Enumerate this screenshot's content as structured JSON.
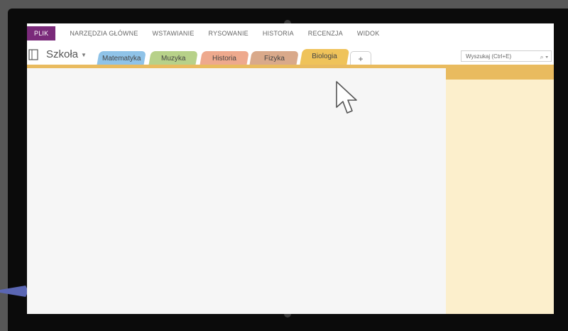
{
  "ribbon": {
    "file": "PLIK",
    "tabs": [
      "NARZĘDZIA GŁÓWNE",
      "WSTAWIANIE",
      "RYSOWANIE",
      "HISTORIA",
      "RECENZJA",
      "WIDOK"
    ]
  },
  "notebook": {
    "name": "Szkoła",
    "icon": "notebook-icon",
    "sections": [
      {
        "label": "Matematyka",
        "color": "#8fc3e8"
      },
      {
        "label": "Muzyka",
        "color": "#b7d189"
      },
      {
        "label": "Historia",
        "color": "#eea98d"
      },
      {
        "label": "Fizyka",
        "color": "#d9a98a"
      },
      {
        "label": "Biologia",
        "color": "#efc35a"
      }
    ],
    "add_tab": "+"
  },
  "search": {
    "placeholder": "Wyszukaj (Ctrl+E)"
  },
  "colors": {
    "accent": "#e9bb5f",
    "page_list": "#fcefcc",
    "file_tab": "#7a2a7a"
  }
}
